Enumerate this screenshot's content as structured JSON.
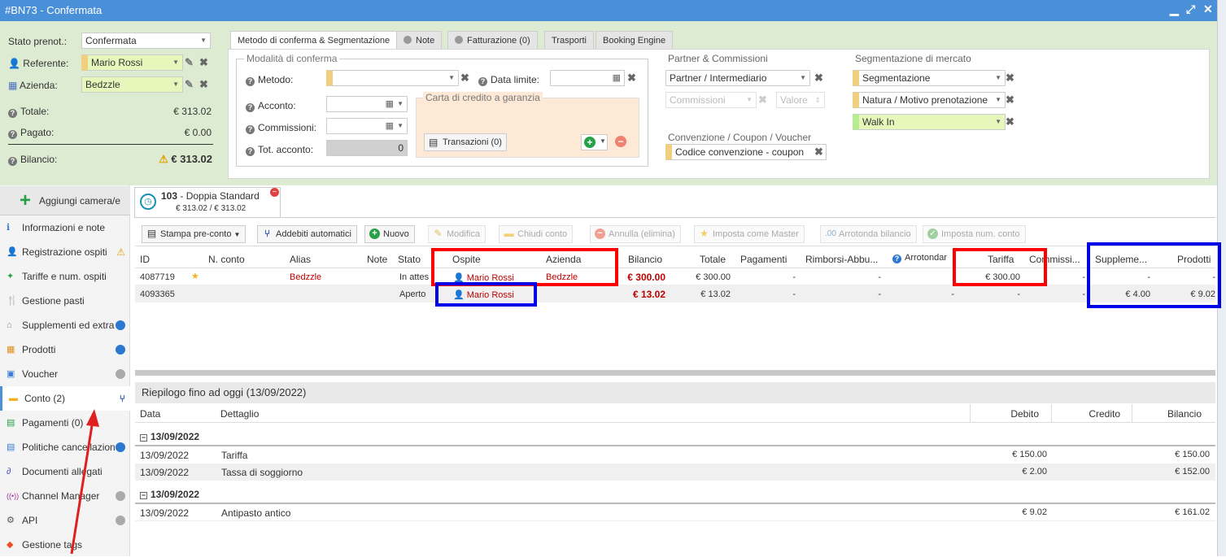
{
  "window": {
    "title": "#BN73 - Confermata"
  },
  "header": {
    "stato_label": "Stato prenot.:",
    "stato_value": "Confermata",
    "referente_label": "Referente:",
    "referente_value": "Mario Rossi",
    "azienda_label": "Azienda:",
    "azienda_value": "Bedzzle",
    "totale_label": "Totale:",
    "totale_value": "€ 313.02",
    "pagato_label": "Pagato:",
    "pagato_value": "€ 0.00",
    "bilancio_label": "Bilancio:",
    "bilancio_value": "€ 313.02"
  },
  "tabs": [
    {
      "label": "Metodo di conferma & Segmentazione"
    },
    {
      "label": "Note"
    },
    {
      "label": "Fatturazione (0)"
    },
    {
      "label": "Trasporti"
    },
    {
      "label": "Booking Engine"
    }
  ],
  "conferma": {
    "legend": "Modalità di conferma",
    "metodo_label": "Metodo:",
    "data_limite_label": "Data limite:",
    "acconto_label": "Acconto:",
    "commissioni_label": "Commissioni:",
    "tot_acconto_label": "Tot. acconto:",
    "tot_acconto_value": "0",
    "carta_legend": "Carta di credito a garanzia",
    "transazioni_button": "Transazioni (0)"
  },
  "partner": {
    "title": "Partner & Commissioni",
    "partner_placeholder": "Partner / Intermediario",
    "commissioni_placeholder": "Commissioni",
    "valore_placeholder": "Valore",
    "convenzione_title": "Convenzione / Coupon / Voucher",
    "convenzione_placeholder": "Codice convenzione - coupon"
  },
  "segmentazione": {
    "title": "Segmentazione di mercato",
    "segmentazione_placeholder": "Segmentazione",
    "natura_placeholder": "Natura / Motivo prenotazione",
    "walkin_value": "Walk In"
  },
  "sidebar": {
    "add_button": "Aggiungi camera/e",
    "items": [
      {
        "label": "Informazioni e note"
      },
      {
        "label": "Registrazione ospiti"
      },
      {
        "label": "Tariffe e num. ospiti"
      },
      {
        "label": "Gestione pasti"
      },
      {
        "label": "Supplementi ed extra"
      },
      {
        "label": "Prodotti"
      },
      {
        "label": "Voucher"
      },
      {
        "label": "Conto (2)"
      },
      {
        "label": "Pagamenti (0)"
      },
      {
        "label": "Politiche cancellazione"
      },
      {
        "label": "Documenti allegati"
      },
      {
        "label": "Channel Manager"
      },
      {
        "label": "API"
      },
      {
        "label": "Gestione tags"
      }
    ]
  },
  "room": {
    "number": "103",
    "name": " - Doppia Standard",
    "amount": "€ 313.02 / € 313.02"
  },
  "toolbar": {
    "stampa": "Stampa pre-conto",
    "addebiti": "Addebiti automatici",
    "nuovo": "Nuovo",
    "modifica": "Modifica",
    "chiudi": "Chiudi conto",
    "annulla": "Annulla (elimina)",
    "imposta_master": "Imposta come Master",
    "arrotonda": "Arrotonda bilancio",
    "imposta_num": "Imposta num. conto"
  },
  "accounts": {
    "headers": [
      "ID",
      "N. conto",
      "Alias",
      "Note",
      "Stato",
      "Ospite",
      "Azienda",
      "Bilancio",
      "Totale",
      "Pagamenti",
      "Rimborsi-Abbu...",
      "Arrotondar",
      "Tariffa",
      "Commissi...",
      "Suppleme...",
      "Prodotti"
    ],
    "rows": [
      {
        "id": "4087719",
        "alias": "Bedzzle",
        "stato": "In attes",
        "ospite": "Mario Rossi",
        "azienda": "Bedzzle",
        "bilancio": "€ 300.00",
        "totale": "€ 300.00",
        "pagamenti": "-",
        "rimborsi": "-",
        "arrotonda": "",
        "tariffa": "€ 300.00",
        "commissioni": "-",
        "supplementi": "-",
        "prodotti": "-"
      },
      {
        "id": "4093365",
        "alias": "",
        "stato": "Aperto",
        "ospite": "Mario Rossi",
        "azienda": "",
        "bilancio": "€ 13.02",
        "totale": "€ 13.02",
        "pagamenti": "-",
        "rimborsi": "-",
        "arrotonda": "-",
        "tariffa": "-",
        "commissioni": "-",
        "supplementi": "€ 4.00",
        "prodotti": "€ 9.02"
      }
    ]
  },
  "recap": {
    "title": "Riepilogo fino ad oggi (13/09/2022)",
    "headers": [
      "Data",
      "Dettaglio",
      "Debito",
      "Credito",
      "Bilancio"
    ],
    "groups": [
      {
        "date": "13/09/2022",
        "rows": [
          {
            "data": "13/09/2022",
            "dettaglio": "Tariffa",
            "debito": "€ 150.00",
            "credito": "",
            "bilancio": "€ 150.00"
          },
          {
            "data": "13/09/2022",
            "dettaglio": "Tassa di soggiorno",
            "debito": "€ 2.00",
            "credito": "",
            "bilancio": "€ 152.00"
          }
        ]
      },
      {
        "date": "13/09/2022",
        "rows": [
          {
            "data": "13/09/2022",
            "dettaglio": "Antipasto antico",
            "debito": "€ 9.02",
            "credito": "",
            "bilancio": "€ 161.02"
          }
        ]
      }
    ]
  },
  "colors": {
    "titlebar": "#4a90d9",
    "header_bg": "#dcebd2",
    "highlight_red": "#ff0000",
    "highlight_blue": "#0000e8",
    "arrow": "#e02020"
  }
}
